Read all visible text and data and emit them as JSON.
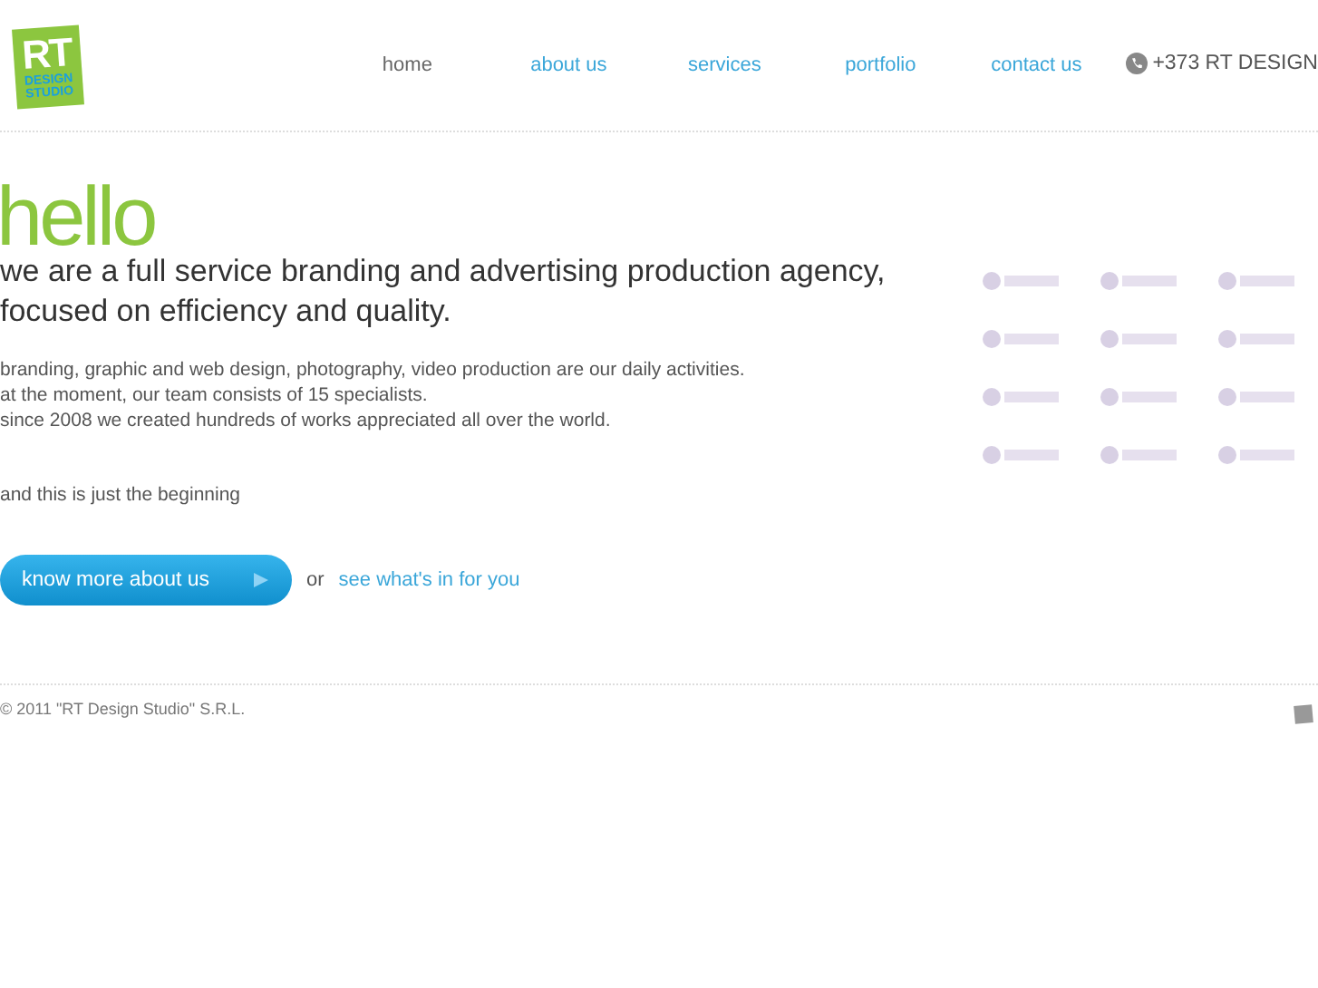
{
  "logo": {
    "line_1": "RT",
    "line_2": "DESIGN",
    "line_3": "STUDIO"
  },
  "nav": [
    {
      "label": "home",
      "selected": true
    },
    {
      "label": "about us",
      "selected": false
    },
    {
      "label": "services",
      "selected": false
    },
    {
      "label": "portfolio",
      "selected": false
    },
    {
      "label": "contact us",
      "selected": false
    }
  ],
  "phone": "+373 RT DESIGN",
  "intro": {
    "greeting": "hello",
    "headline": "we are a full service branding and advertising production agency, focused on efficiency and quality.",
    "paragraph": [
      "branding, graphic and web design, photography, video production are our daily activities.",
      "at the moment, our team consists of 15 specialists.",
      "since 2008 we created hundreds of works appreciated all over the world."
    ],
    "closing": "and this is just the beginning"
  },
  "cta": {
    "button": "know more about us",
    "or": "or",
    "link": "see what's in for you"
  },
  "footer": {
    "copyright": "© 2011 \"RT Design Studio\" S.R.L."
  }
}
